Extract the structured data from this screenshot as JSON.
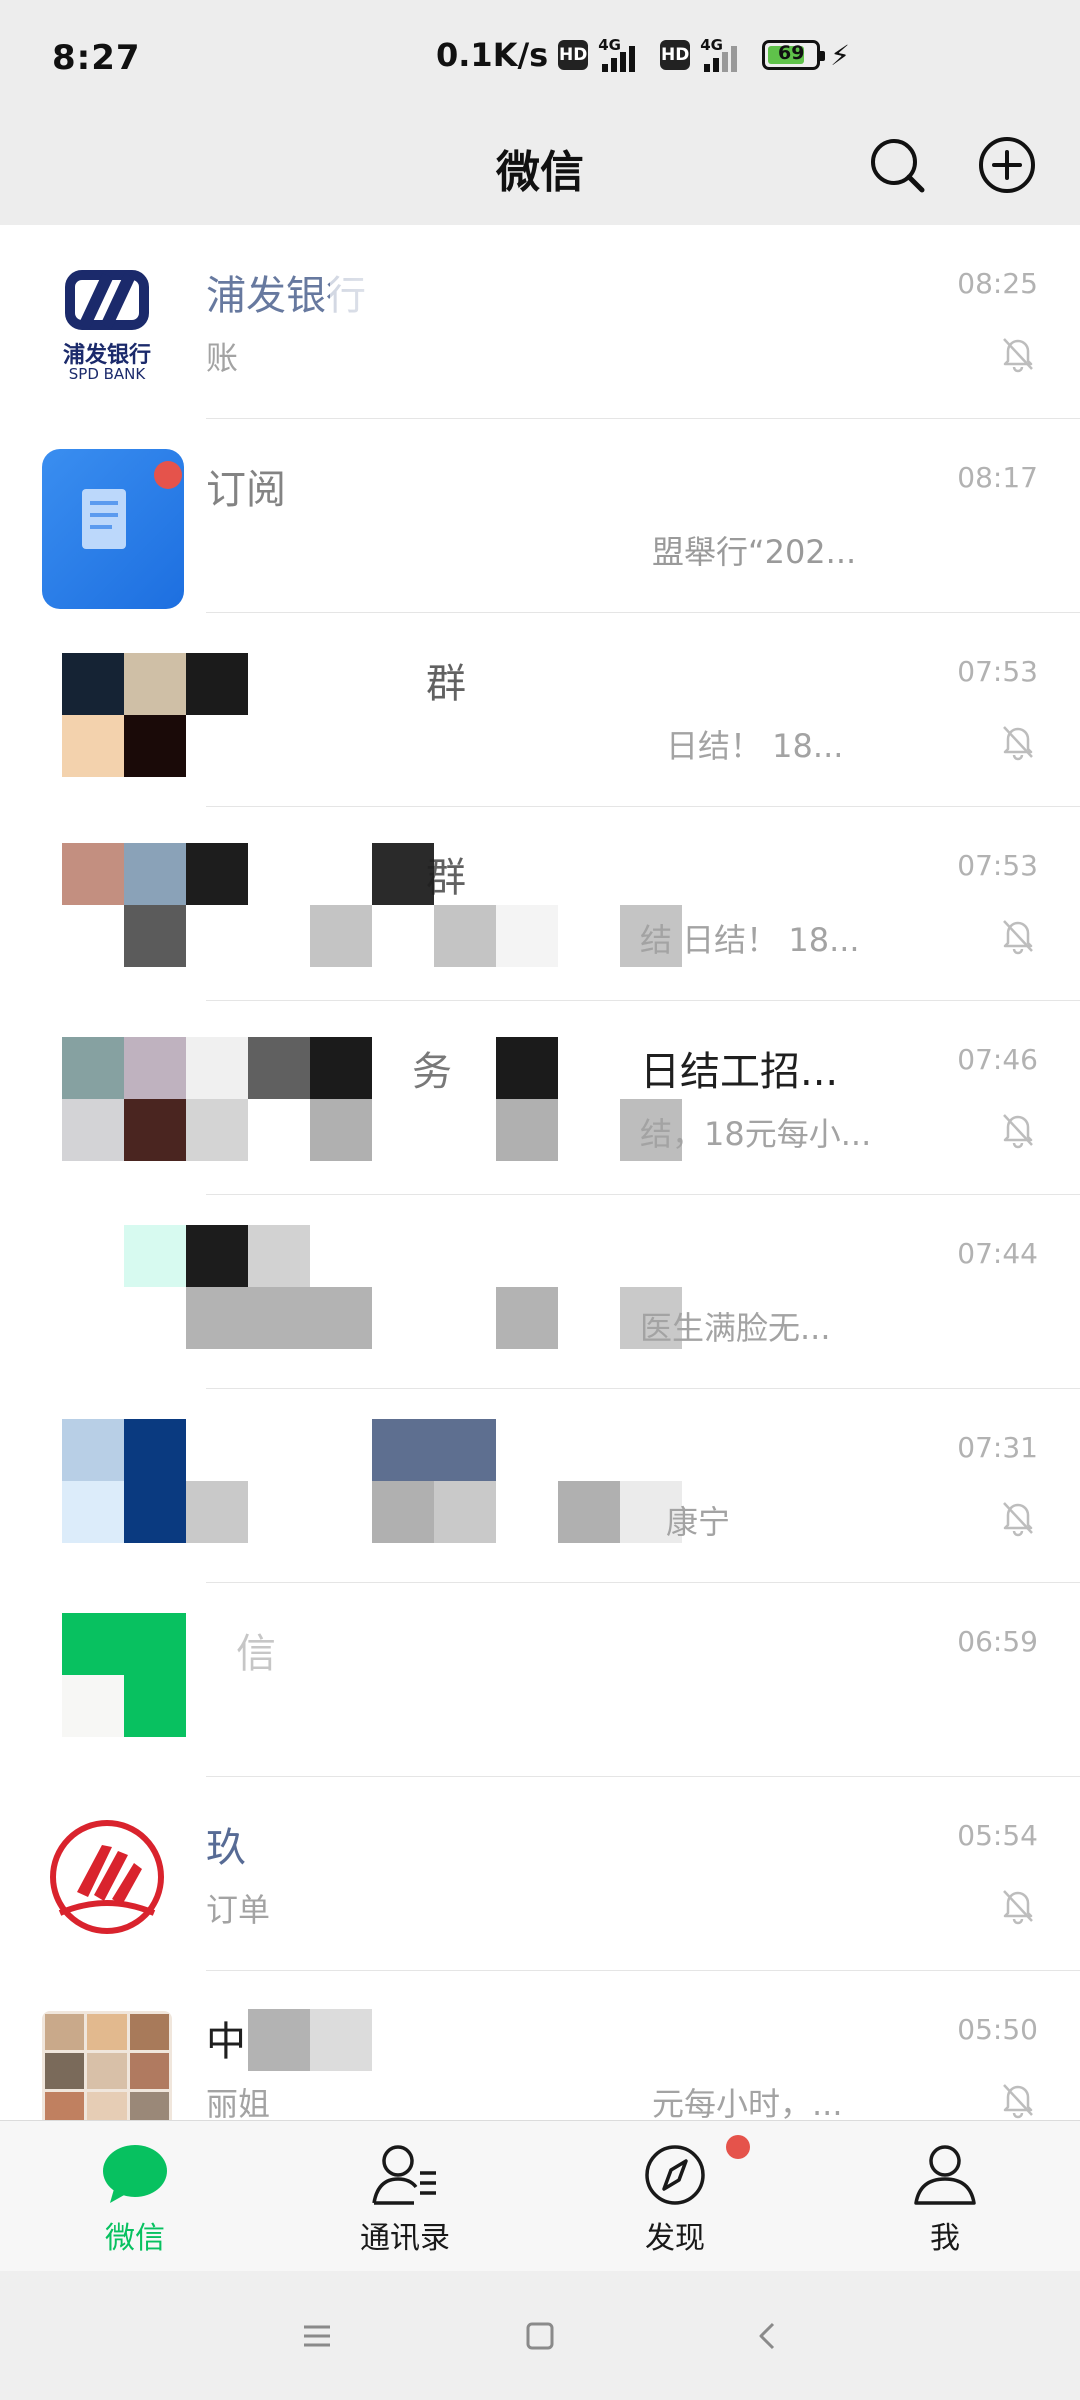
{
  "status": {
    "time": "8:27",
    "net_speed": "0.1K/s",
    "hd": "HD",
    "network": "4G",
    "battery": "69"
  },
  "header": {
    "title": "微信",
    "search_icon": "search-icon",
    "add_icon": "plus-circle-icon"
  },
  "chats": [
    {
      "name": "浦发银行",
      "preview": "账",
      "time": "08:25",
      "muted": true,
      "avatar_text": "浦发银行",
      "avatar_sub": "SPD BANK"
    },
    {
      "name": "订阅",
      "preview": "盟舉行“202...",
      "time": "08:17",
      "muted": false
    },
    {
      "name": "群",
      "preview": "日结！ 18...",
      "time": "07:53",
      "muted": true
    },
    {
      "name": "群",
      "preview": "结 日结！ 18...",
      "time": "07:53",
      "muted": true
    },
    {
      "name": "务",
      "name_suffix": "日结工招...",
      "preview": "结，18元每小...",
      "time": "07:46",
      "muted": true
    },
    {
      "name": "",
      "preview": "医生满脸无...",
      "time": "07:44",
      "muted": false
    },
    {
      "name": "",
      "preview": "康宁",
      "time": "07:31",
      "muted": true
    },
    {
      "name": "信",
      "preview": "",
      "time": "06:59",
      "muted": false
    },
    {
      "name": "玖",
      "preview": "订单",
      "time": "05:54",
      "muted": true
    },
    {
      "name": "中",
      "preview": "丽姐",
      "preview_suffix": "元每小时，...",
      "time": "05:50",
      "muted": true
    }
  ],
  "tabs": [
    {
      "label": "微信",
      "active": true
    },
    {
      "label": "通讯录",
      "active": false
    },
    {
      "label": "发现",
      "active": false,
      "badge": true
    },
    {
      "label": "我",
      "active": false
    }
  ],
  "colors": {
    "accent": "#07c160",
    "badge": "#e5534b",
    "official_name": "#576b95"
  }
}
